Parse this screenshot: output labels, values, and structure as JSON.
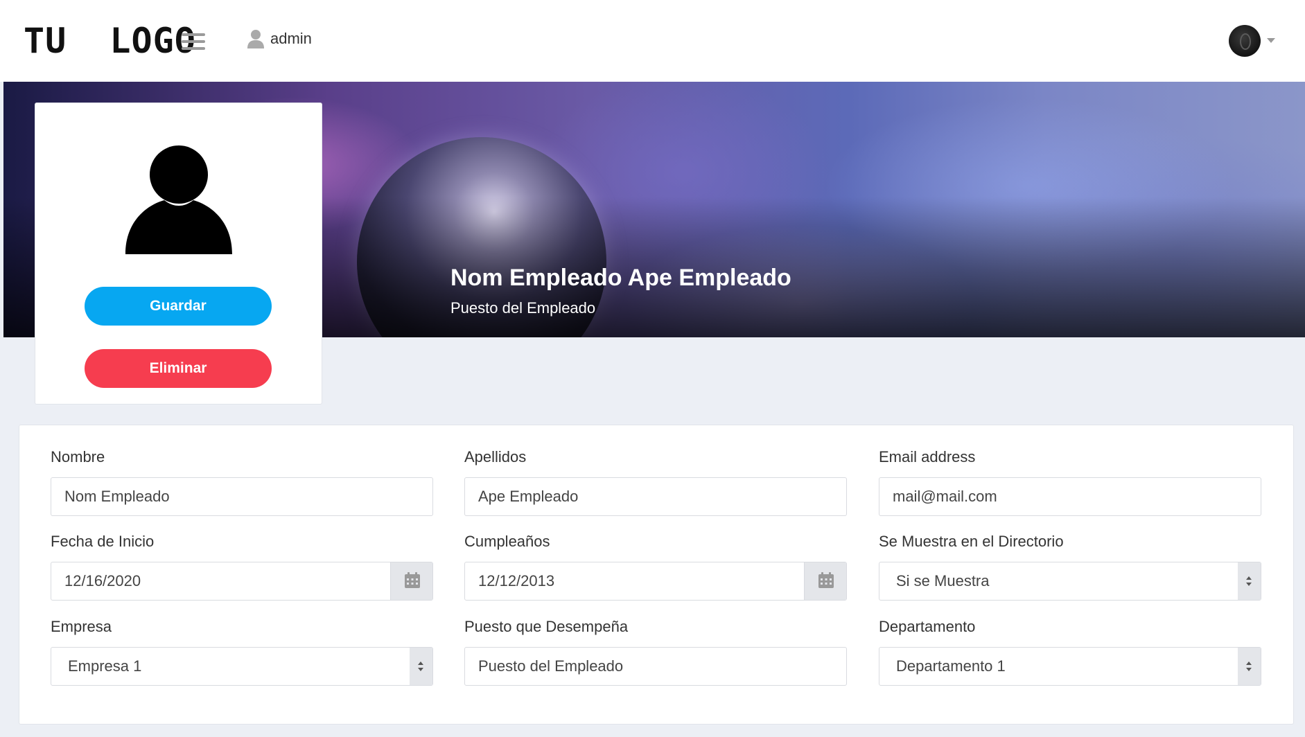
{
  "header": {
    "logo": "TU  LOGO",
    "user_name": "admin",
    "icons": [
      "menu-icon",
      "user-icon",
      "avatar",
      "caret-down-icon"
    ]
  },
  "banner": {
    "employee_name": "Nom Empleado Ape Empleado",
    "employee_role": "Puesto del Empleado"
  },
  "profile": {
    "save_label": "Guardar",
    "delete_label": "Eliminar",
    "colors": {
      "save": "#07a7f1",
      "delete": "#f63d4f"
    }
  },
  "form": {
    "nombre": {
      "label": "Nombre",
      "value": "Nom Empleado"
    },
    "apellidos": {
      "label": "Apellidos",
      "value": "Ape Empleado"
    },
    "email": {
      "label": "Email address",
      "value": "mail@mail.com"
    },
    "fecha_inicio": {
      "label": "Fecha de Inicio",
      "value": "12/16/2020",
      "icon": "calendar-icon"
    },
    "cumpleanos": {
      "label": "Cumpleaños",
      "value": "12/12/2013",
      "icon": "calendar-icon"
    },
    "directorio": {
      "label": "Se Muestra en el Directorio",
      "value": "Si se Muestra"
    },
    "empresa": {
      "label": "Empresa",
      "value": "Empresa 1"
    },
    "puesto": {
      "label": "Puesto que Desempeña",
      "value": "Puesto del Empleado"
    },
    "departamento": {
      "label": "Departamento",
      "value": "Departamento 1"
    }
  }
}
